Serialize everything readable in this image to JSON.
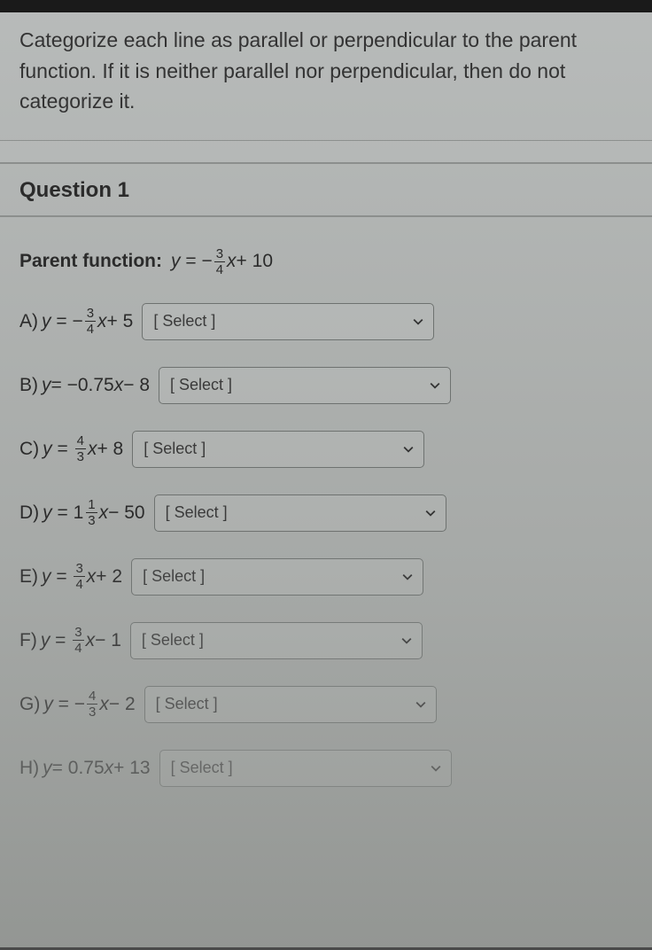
{
  "instructions": "Categorize each line as parallel or perpendicular to the parent function. If it is neither parallel nor perpendicular, then do not categorize it.",
  "question_header": "Question 1",
  "parent_label": "Parent function:",
  "parent_eq": {
    "sign": "−",
    "num": "3",
    "den": "4",
    "tail": " + 10"
  },
  "select_placeholder": "[ Select ]",
  "items": [
    {
      "id": "A",
      "label": "A)",
      "type": "frac",
      "sign": "−",
      "num": "3",
      "den": "4",
      "tail": " + 5"
    },
    {
      "id": "B",
      "label": "B)",
      "type": "dec",
      "body": " = −0.75",
      "tail": " − 8"
    },
    {
      "id": "C",
      "label": "C)",
      "type": "frac",
      "sign": "",
      "num": "4",
      "den": "3",
      "tail": " + 8"
    },
    {
      "id": "D",
      "label": "D)",
      "type": "mixed",
      "sign": "",
      "whole": "1",
      "num": "1",
      "den": "3",
      "tail": " − 50"
    },
    {
      "id": "E",
      "label": "E)",
      "type": "frac",
      "sign": "",
      "num": "3",
      "den": "4",
      "tail": " + 2"
    },
    {
      "id": "F",
      "label": "F)",
      "type": "frac",
      "sign": "",
      "num": "3",
      "den": "4",
      "tail": " − 1"
    },
    {
      "id": "G",
      "label": "G)",
      "type": "frac",
      "sign": "−",
      "num": "4",
      "den": "3",
      "tail": " − 2"
    },
    {
      "id": "H",
      "label": "H)",
      "type": "dec",
      "body": " = 0.75",
      "tail": " + 13"
    }
  ]
}
